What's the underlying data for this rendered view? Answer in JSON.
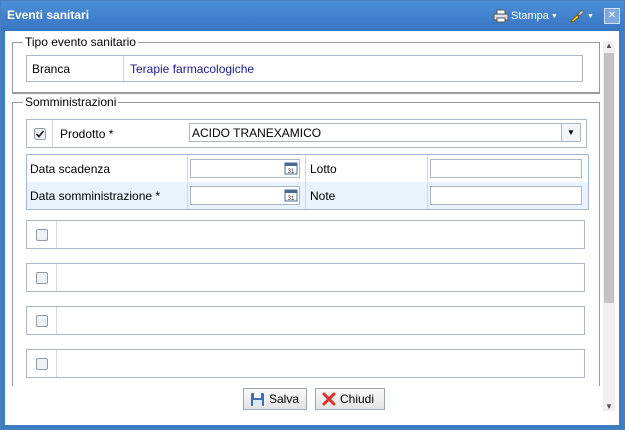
{
  "window": {
    "title": "Eventi sanitari",
    "print_label": "Stampa"
  },
  "tipo_evento": {
    "legend": "Tipo evento sanitario",
    "branca_label": "Branca",
    "branca_value": "Terapie farmacologiche"
  },
  "somministrazioni": {
    "legend": "Somministrazioni",
    "prodotto_label": "Prodotto *",
    "prodotto_value": "ACIDO TRANEXAMICO",
    "data_scadenza_label": "Data scadenza",
    "lotto_label": "Lotto",
    "data_somministrazione_label": "Data somministrazione *",
    "note_label": "Note"
  },
  "buttons": {
    "save": "Salva",
    "close": "Chiudi"
  },
  "colors": {
    "accent": "#3e7cc4",
    "link_text": "#1a1a8c",
    "close_icon": "#d9302a",
    "save_icon": "#3d6fb5"
  }
}
